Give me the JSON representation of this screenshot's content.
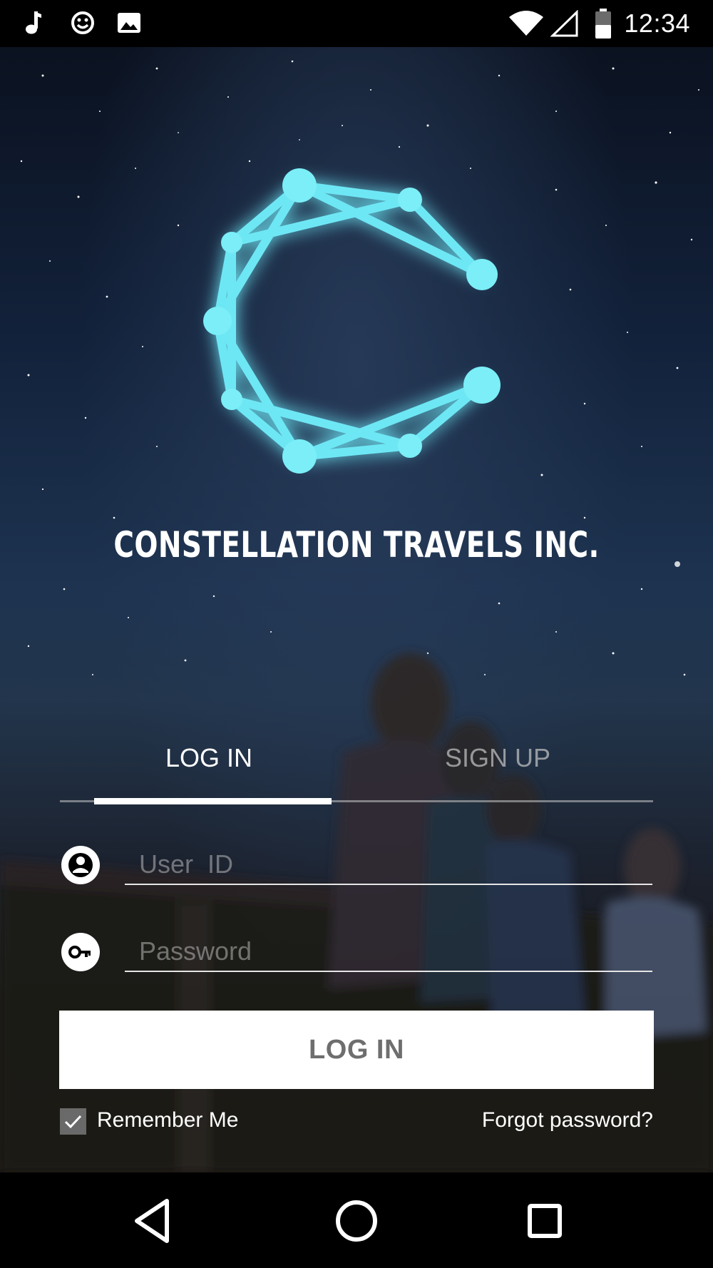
{
  "status_bar": {
    "time": "12:34",
    "icons": [
      "music-note-icon",
      "smiley-icon",
      "image-icon",
      "wifi-icon",
      "cellular-signal-icon",
      "battery-icon"
    ]
  },
  "brand": {
    "logo": "constellation-c-logo",
    "name": "CONSTELLATION TRAVELS INC.",
    "logo_color": "#5fe6f5"
  },
  "tabs": [
    {
      "label": "LOG IN",
      "active": true
    },
    {
      "label": "SIGN UP",
      "active": false
    }
  ],
  "form": {
    "user_id_placeholder": "User  ID",
    "password_placeholder": "Password",
    "user_icon": "person-icon",
    "password_icon": "key-icon",
    "submit_label": "LOG IN",
    "remember_label": "Remember Me",
    "remember_checked": true,
    "forgot_label": "Forgot password?"
  },
  "nav_bar": {
    "buttons": [
      "back-icon",
      "home-icon",
      "recents-icon"
    ]
  }
}
